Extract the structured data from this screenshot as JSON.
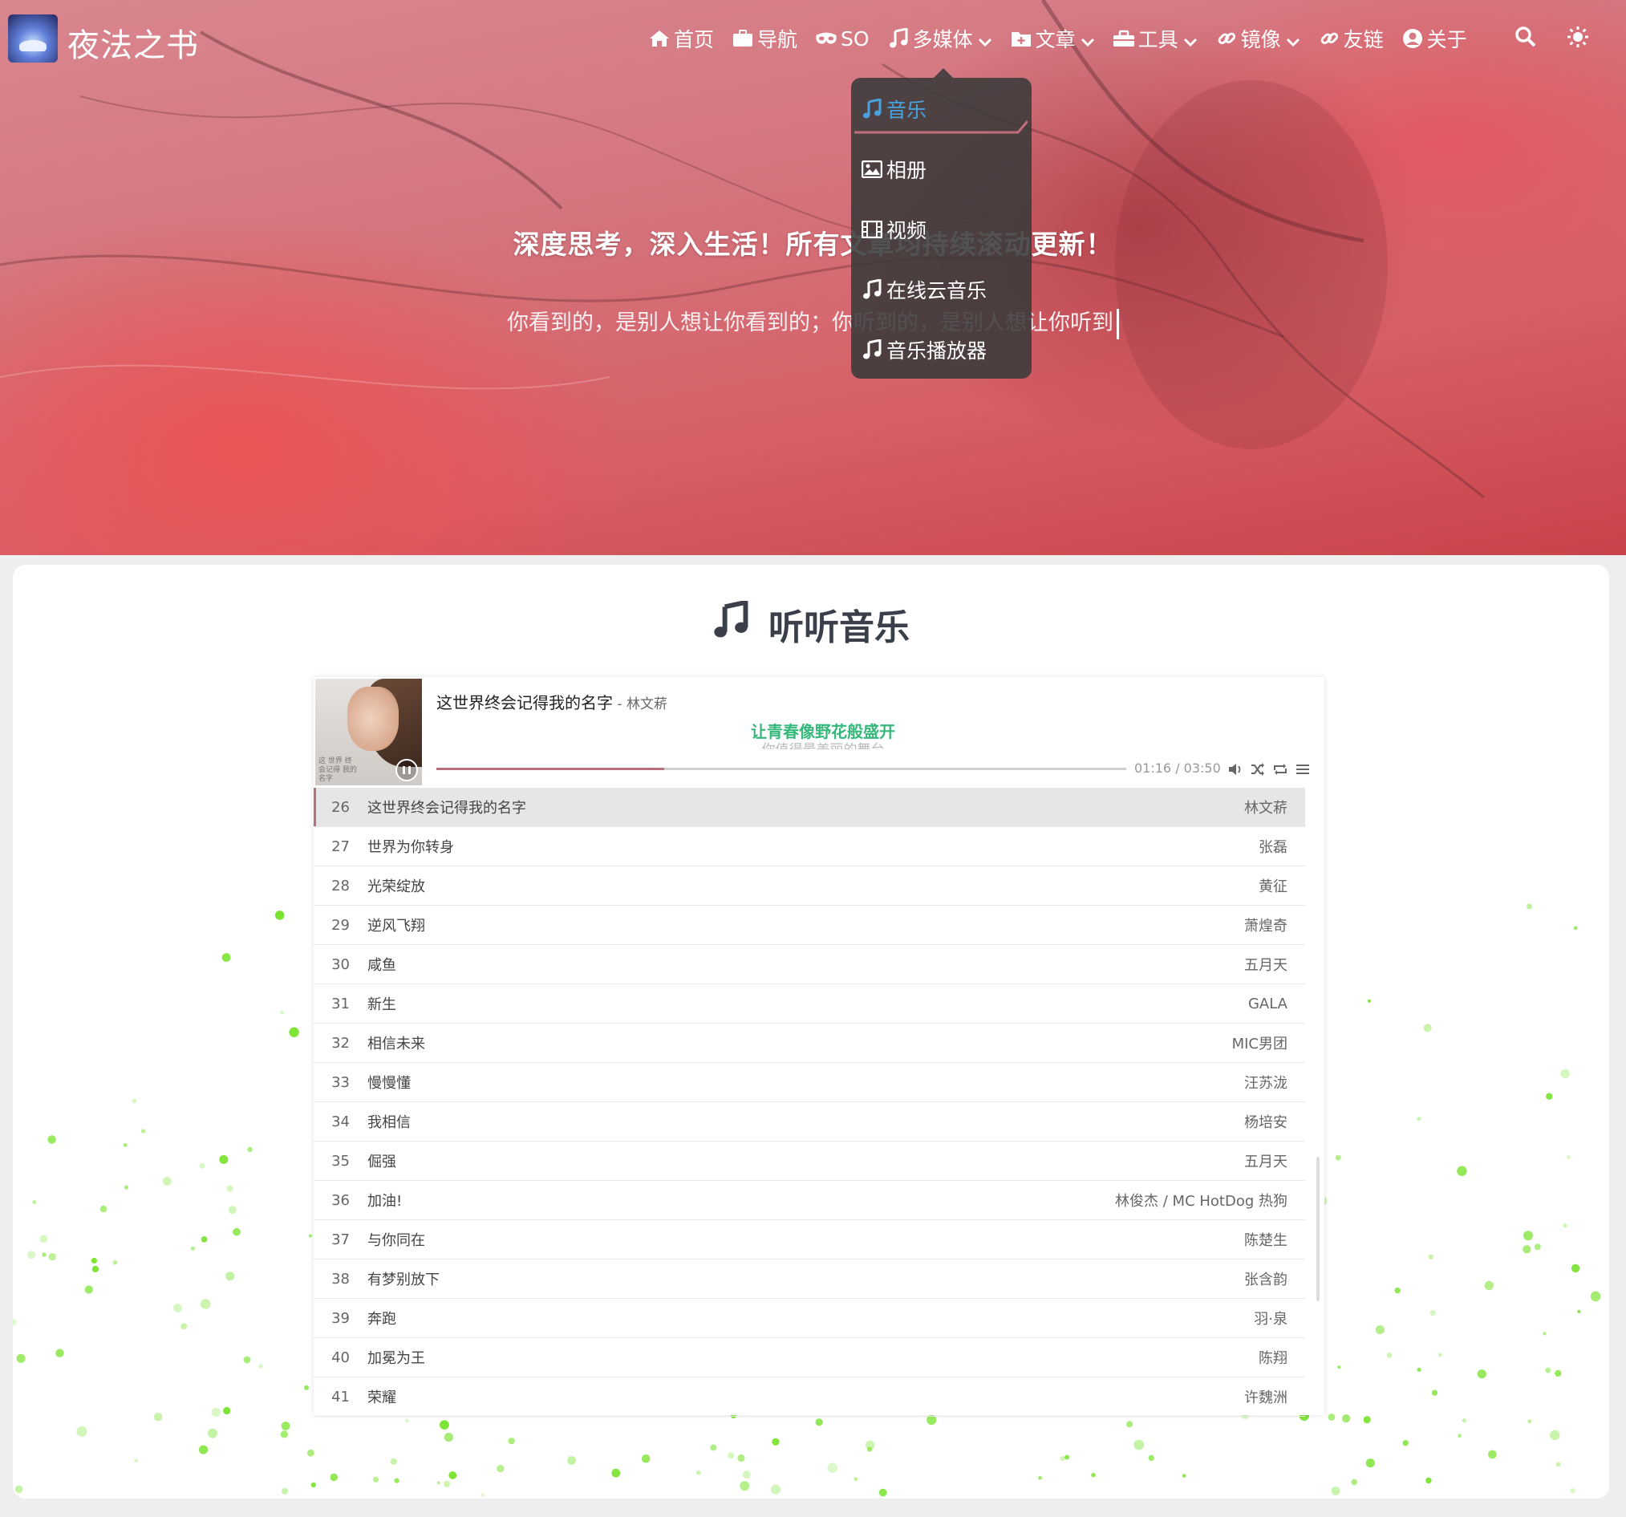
{
  "site": {
    "name": "夜法之书"
  },
  "nav": {
    "items": [
      {
        "label": "首页",
        "icon": "home-icon"
      },
      {
        "label": "导航",
        "icon": "briefcase-icon"
      },
      {
        "label": "SO",
        "icon": "mask-icon"
      },
      {
        "label": "多媒体",
        "icon": "music-icon",
        "dropdown": true
      },
      {
        "label": "文章",
        "icon": "folder-plus-icon",
        "dropdown": true
      },
      {
        "label": "工具",
        "icon": "toolbox-icon",
        "dropdown": true
      },
      {
        "label": "镜像",
        "icon": "link-icon",
        "dropdown": true
      },
      {
        "label": "友链",
        "icon": "link-icon"
      },
      {
        "label": "关于",
        "icon": "user-circle-icon"
      }
    ],
    "search_icon": "search-icon",
    "theme_icon": "sun-icon"
  },
  "dropdown": {
    "items": [
      {
        "label": "音乐",
        "icon": "music-icon",
        "active": true
      },
      {
        "label": "相册",
        "icon": "image-icon"
      },
      {
        "label": "视频",
        "icon": "film-icon"
      },
      {
        "label": "在线云音乐",
        "icon": "music-icon"
      },
      {
        "label": "音乐播放器",
        "icon": "music-icon"
      }
    ]
  },
  "hero": {
    "title": "深度思考，深入生活！所有文章均持续滚动更新！",
    "subtitle": "你看到的，是别人想让你看到的；你听到的，是别人想让你听到"
  },
  "section": {
    "title": "听听音乐",
    "icon": "music-icon"
  },
  "player": {
    "now_playing": {
      "title": "这世界终会记得我的名字",
      "separator": " - ",
      "artist": "林文菥"
    },
    "lyric_current": "让青春像野花般盛开",
    "lyric_next": "你值得最美丽的舞台",
    "time": "01:16 / 03:50",
    "progress": 0.33,
    "cover_text": "这 世界 终会记得 我的名字",
    "controls": [
      "volume-icon",
      "shuffle-icon",
      "repeat-icon",
      "playlist-icon"
    ],
    "playlist": [
      {
        "num": "26",
        "title": "这世界终会记得我的名字",
        "artist": "林文菥",
        "current": true
      },
      {
        "num": "27",
        "title": "世界为你转身",
        "artist": "张磊"
      },
      {
        "num": "28",
        "title": "光荣绽放",
        "artist": "黄征"
      },
      {
        "num": "29",
        "title": "逆风飞翔",
        "artist": "萧煌奇"
      },
      {
        "num": "30",
        "title": "咸鱼",
        "artist": "五月天"
      },
      {
        "num": "31",
        "title": "新生",
        "artist": "GALA"
      },
      {
        "num": "32",
        "title": "相信未来",
        "artist": "MIC男团"
      },
      {
        "num": "33",
        "title": "慢慢懂",
        "artist": "汪苏泷"
      },
      {
        "num": "34",
        "title": "我相信",
        "artist": "杨培安"
      },
      {
        "num": "35",
        "title": "倔强",
        "artist": "五月天"
      },
      {
        "num": "36",
        "title": "加油!",
        "artist": "林俊杰 / MC HotDog 热狗"
      },
      {
        "num": "37",
        "title": "与你同在",
        "artist": "陈楚生"
      },
      {
        "num": "38",
        "title": "有梦别放下",
        "artist": "张含韵"
      },
      {
        "num": "39",
        "title": "奔跑",
        "artist": "羽·泉"
      },
      {
        "num": "40",
        "title": "加冕为王",
        "artist": "陈翔"
      },
      {
        "num": "41",
        "title": "荣耀",
        "artist": "许魏洲"
      }
    ]
  },
  "colors": {
    "accent": "#4aa3e0",
    "lyric": "#36b87a",
    "progress": "#b7707e",
    "dots": "#7be332"
  }
}
